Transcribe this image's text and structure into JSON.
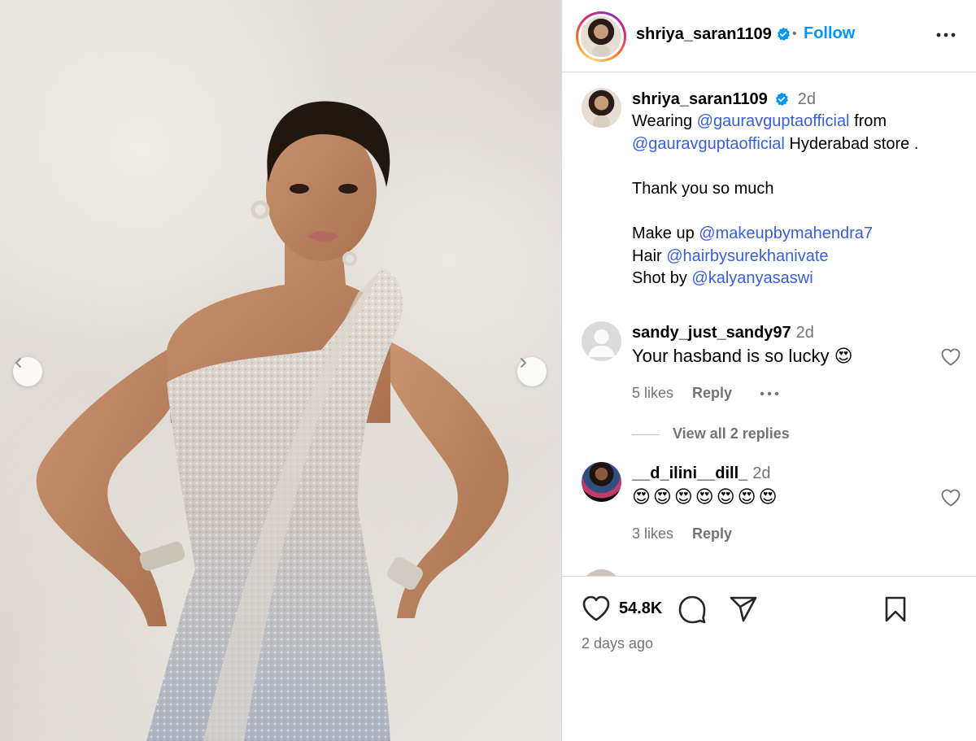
{
  "post": {
    "username": "shriya_saran1109",
    "follow_label": "Follow",
    "dot": "•",
    "likes_count": "54.8K",
    "date": "2 days ago"
  },
  "caption": {
    "username": "shriya_saran1109",
    "time": "2d",
    "line1_prefix": "Wearing ",
    "line1_mention": "@gauravguptaofficial",
    "line1_suffix": " from",
    "line2_mention": "@gauravguptaofficial",
    "line2_suffix": " Hyderabad store .",
    "line3": "Thank you so much",
    "line4_prefix": "Make up ",
    "line4_mention": "@makeupbymahendra7",
    "line5_prefix": "Hair ",
    "line5_mention": "@hairbysurekhanivate",
    "line6_prefix": "Shot by ",
    "line6_mention": "@kalyanyasaswi"
  },
  "comments": [
    {
      "username": "sandy_just_sandy97",
      "time": "2d",
      "text": "Your hasband is so lucky 😍",
      "likes": "5 likes",
      "reply": "Reply",
      "view_replies": "View all 2 replies"
    },
    {
      "username": "__d_ilini__dill_",
      "time": "2d",
      "text": "😍😍😍😍😍😍😍",
      "likes": "3 likes",
      "reply": "Reply"
    }
  ],
  "colors": {
    "accent": "#0095f6",
    "mention": "#385ee0",
    "muted": "#737373",
    "verified": "#0095f6"
  },
  "icons": {
    "like": "heart-icon",
    "comment": "comment-icon",
    "share": "paper-plane-icon",
    "save": "bookmark-icon",
    "more": "more-horizontal-icon",
    "prev": "chevron-left-icon",
    "next": "chevron-right-icon"
  }
}
